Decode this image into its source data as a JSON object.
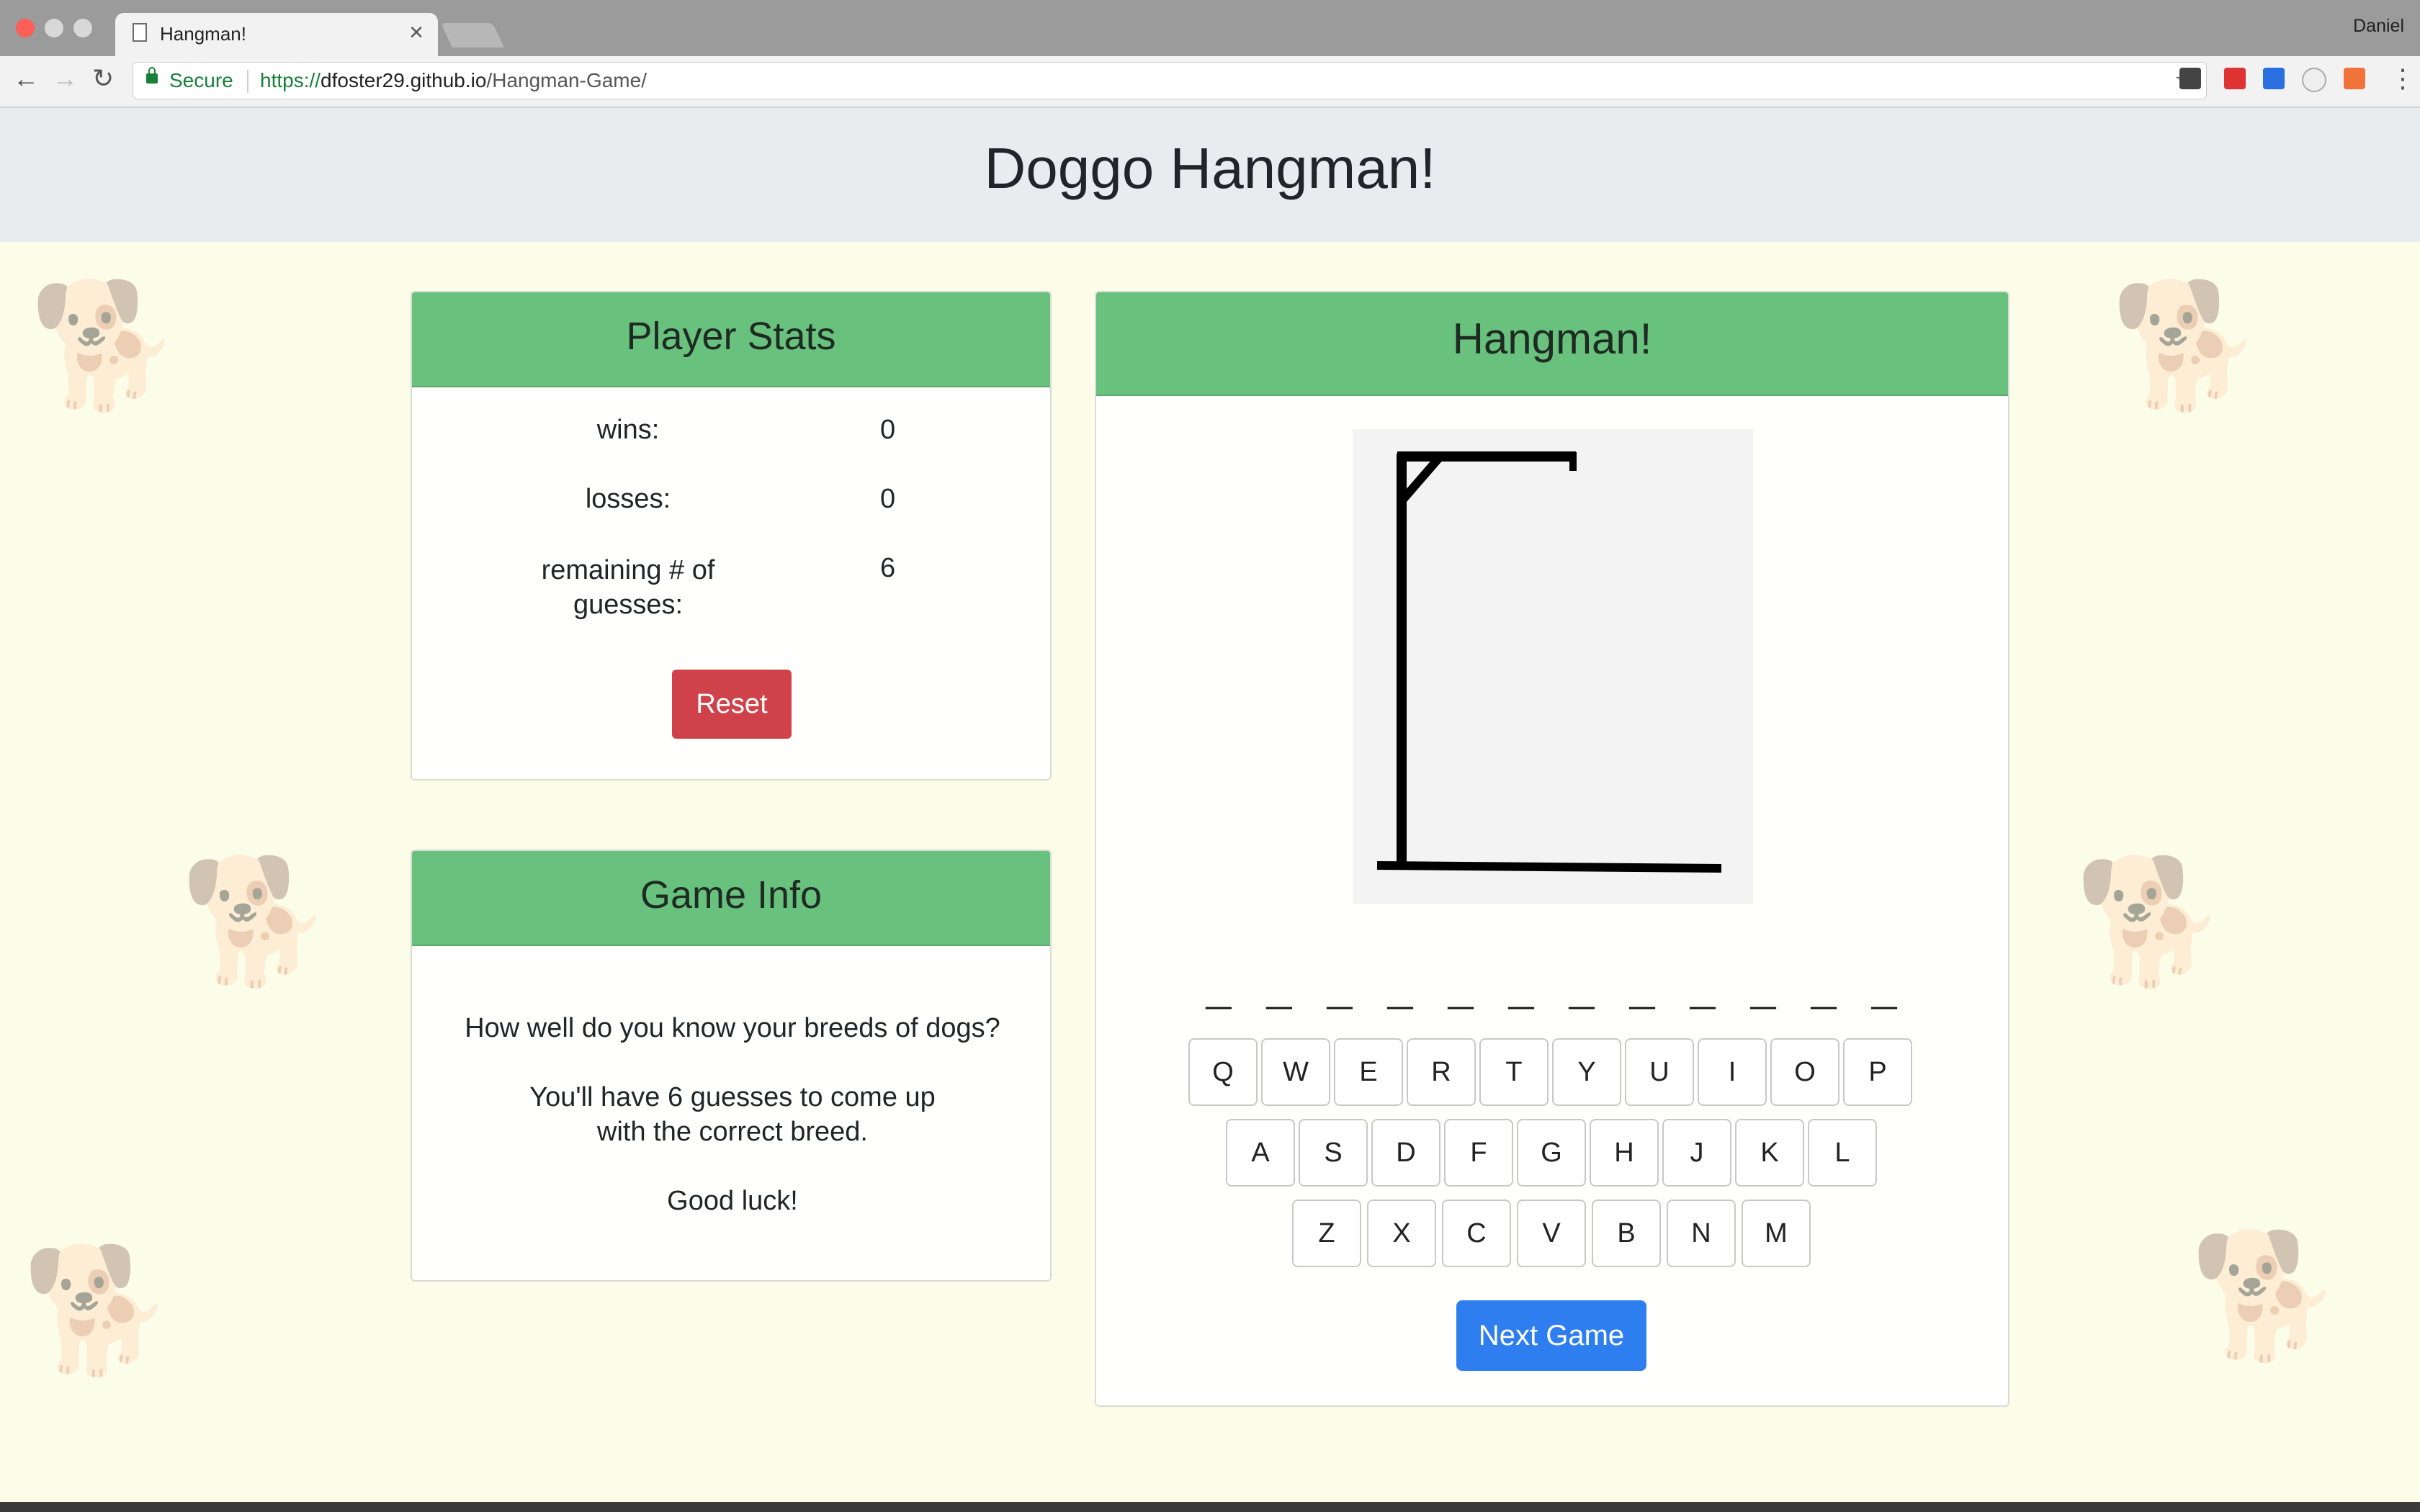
{
  "browser": {
    "tab_title": "Hangman!",
    "profile_name": "Daniel",
    "secure_label": "Secure",
    "url_scheme": "https://",
    "url_host": "dfoster29.github.io",
    "url_path": "/Hangman-Game/"
  },
  "header": {
    "title": "Doggo Hangman!"
  },
  "stats": {
    "heading": "Player Stats",
    "wins_label": "wins:",
    "wins_value": "0",
    "losses_label": "losses:",
    "losses_value": "0",
    "remaining_label": "remaining # of guesses:",
    "remaining_value": "6",
    "reset_label": "Reset"
  },
  "info": {
    "heading": "Game Info",
    "line1": "How well do you know your breeds of dogs?",
    "line2": "You'll have 6 guesses to come up with the correct breed.",
    "line3": "Good luck!"
  },
  "game": {
    "heading": "Hangman!",
    "blanks": "_ _ _ _ _ _ _ _ _ _ _ _",
    "keyboard": {
      "row1": [
        "Q",
        "W",
        "E",
        "R",
        "T",
        "Y",
        "U",
        "I",
        "O",
        "P"
      ],
      "row2": [
        "A",
        "S",
        "D",
        "F",
        "G",
        "H",
        "J",
        "K",
        "L"
      ],
      "row3": [
        "Z",
        "X",
        "C",
        "V",
        "B",
        "N",
        "M"
      ]
    },
    "next_label": "Next Game"
  },
  "colors": {
    "card_header": "#69c17e",
    "reset_button": "#d0424a",
    "next_button": "#2f7ef0",
    "page_background": "#fbfde8"
  }
}
